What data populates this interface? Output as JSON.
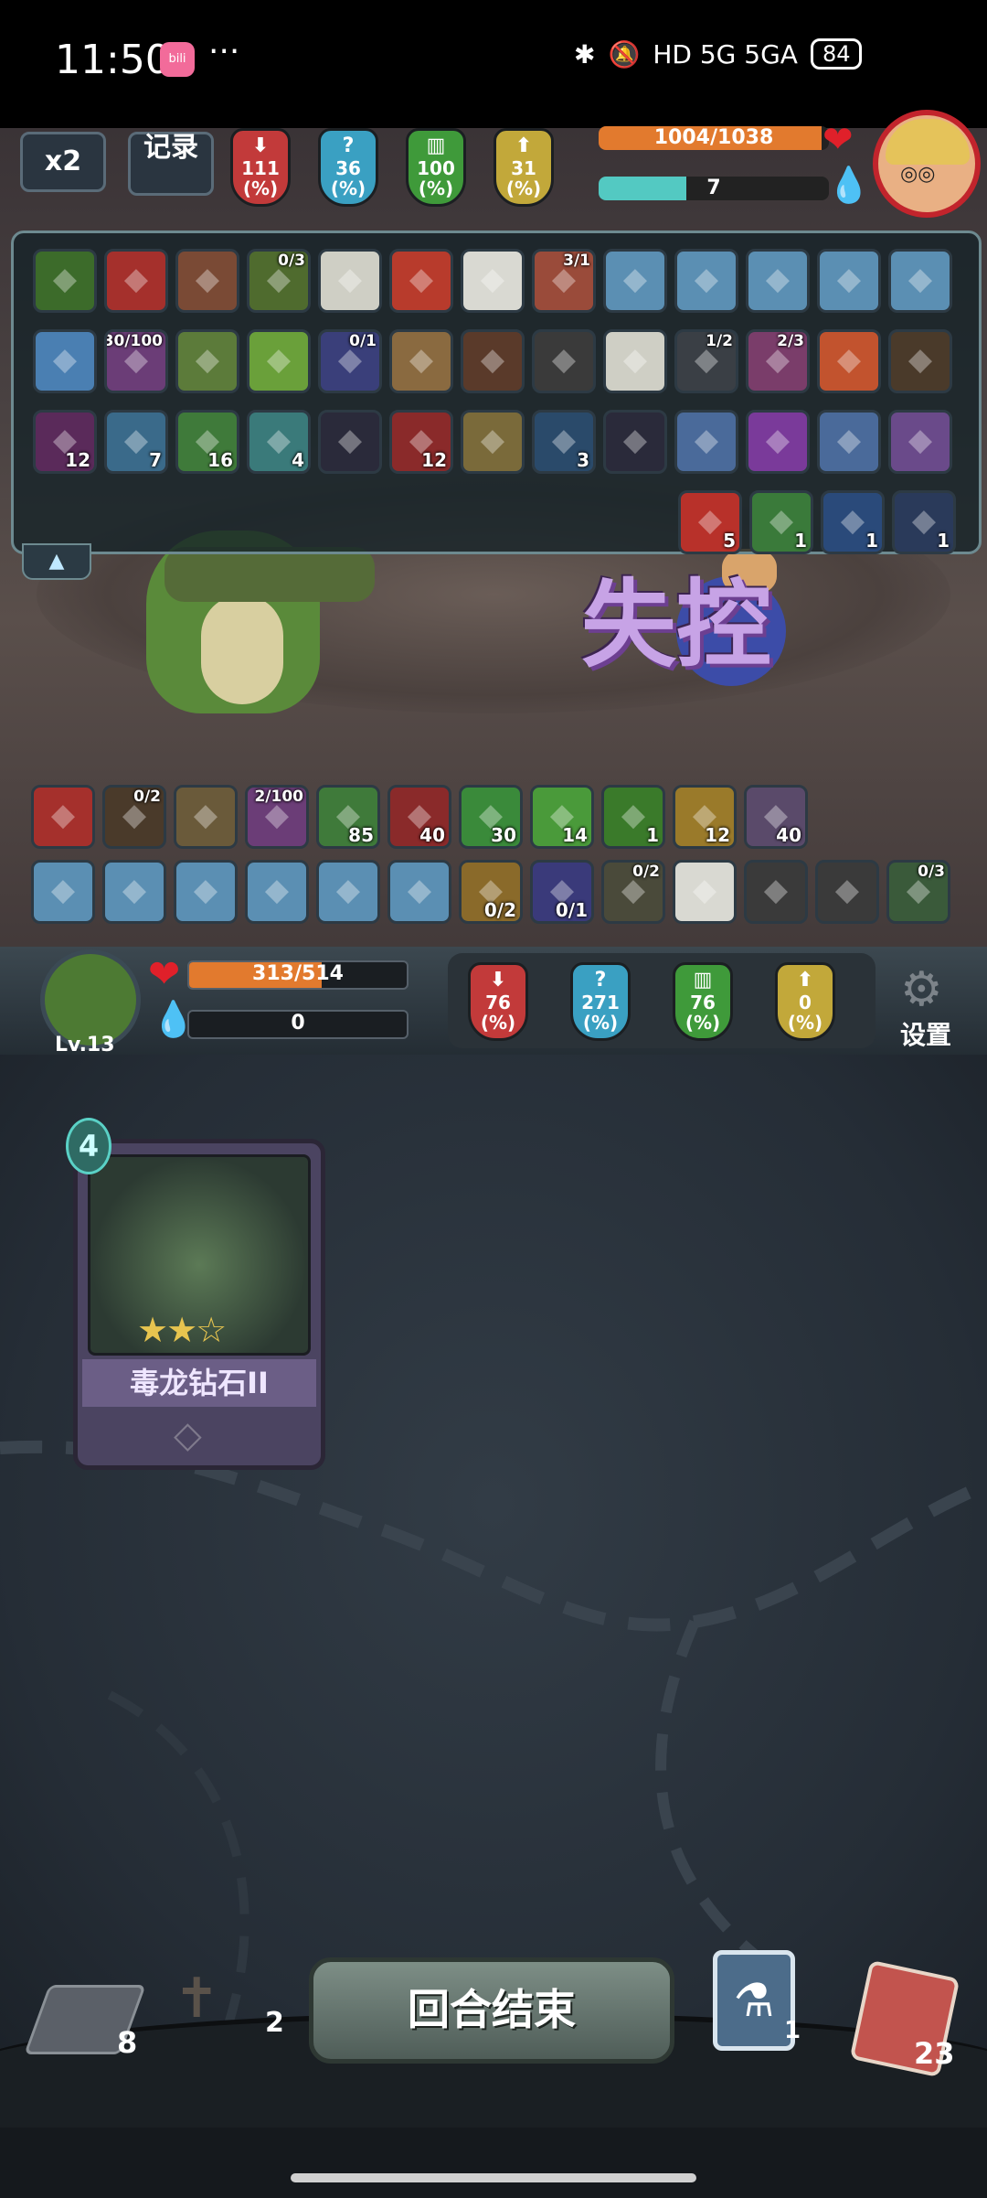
{
  "status_bar": {
    "time": "11:50",
    "app_icon": "bilibili",
    "more": "···",
    "network": "HD 5G 5GA",
    "battery": "84"
  },
  "controls": {
    "speed": "x2",
    "record": "记录"
  },
  "enemy": {
    "hp_text": "1004/1038",
    "hp": 1004,
    "hp_max": 1038,
    "energy": "7",
    "energy_fraction": 0.38,
    "stats": [
      {
        "value": "111",
        "unit": "(%)",
        "icon": "attack-down-icon",
        "color": "#c23a3a"
      },
      {
        "value": "36",
        "unit": "(%)",
        "icon": "unknown-icon",
        "color": "#3aa0c2"
      },
      {
        "value": "100",
        "unit": "(%)",
        "icon": "defense-icon",
        "color": "#3f9a3a"
      },
      {
        "value": "31",
        "unit": "(%)",
        "icon": "crit-icon",
        "color": "#c2a83a"
      }
    ]
  },
  "buff_rows": [
    [
      {
        "icon": "slime-icon",
        "color": "#3c6b2a",
        "tl": "",
        "br": ""
      },
      {
        "icon": "red-demon-icon",
        "color": "#a5302c",
        "tl": "",
        "br": ""
      },
      {
        "icon": "meat-icon",
        "color": "#7a4a35",
        "tl": "",
        "br": ""
      },
      {
        "icon": "zombie-icon",
        "color": "#4f6b2e",
        "tl": "0/3",
        "br": ""
      },
      {
        "icon": "riceball-icon",
        "color": "#cfcfc5",
        "tl": "",
        "br": ""
      },
      {
        "icon": "flask-icon",
        "color": "#b83b2c",
        "tl": "",
        "br": ""
      },
      {
        "icon": "ghost-icon",
        "color": "#d9d9d2",
        "tl": "",
        "br": ""
      },
      {
        "icon": "brute-icon",
        "color": "#9a4b3a",
        "tl": "3/1",
        "br": ""
      },
      {
        "icon": "pumpkin-icon",
        "color": "#5b8fb3",
        "tl": "",
        "br": ""
      },
      {
        "icon": "eye-icon",
        "color": "#5b8fb3",
        "tl": "",
        "br": ""
      },
      {
        "icon": "tentacle-icon",
        "color": "#5b8fb3",
        "tl": "",
        "br": ""
      },
      {
        "icon": "fist-icon",
        "color": "#5b8fb3",
        "tl": "",
        "br": ""
      },
      {
        "icon": "vortex-icon",
        "color": "#5b8fb3",
        "tl": "",
        "br": ""
      }
    ],
    [
      {
        "icon": "swirl-icon",
        "color": "#4a7fb2",
        "tl": "",
        "br": ""
      },
      {
        "icon": "purple-ogre-icon",
        "color": "#6b3d77",
        "tl": "30/100",
        "br": ""
      },
      {
        "icon": "dagger-icon",
        "color": "#5c7b3a",
        "tl": "",
        "br": ""
      },
      {
        "icon": "cup-icon",
        "color": "#6aa03a",
        "tl": "",
        "br": ""
      },
      {
        "icon": "galaxy-icon",
        "color": "#3a3f7a",
        "tl": "0/1",
        "br": ""
      },
      {
        "icon": "hat-icon",
        "color": "#8a6a40",
        "tl": "",
        "br": ""
      },
      {
        "icon": "glove-icon",
        "color": "#5a3a2a",
        "tl": "",
        "br": ""
      },
      {
        "icon": "trap-icon",
        "color": "#3a3a3a",
        "tl": "",
        "br": ""
      },
      {
        "icon": "boot-icon",
        "color": "#cfcfc5",
        "tl": "",
        "br": ""
      },
      {
        "icon": "binocular-icon",
        "color": "#3a3f45",
        "tl": "1/2",
        "br": ""
      },
      {
        "icon": "worm-icon",
        "color": "#7a3d6a",
        "tl": "2/3",
        "br": ""
      },
      {
        "icon": "book-icon",
        "color": "#c2532e",
        "tl": "",
        "br": ""
      },
      {
        "icon": "wood-icon",
        "color": "#4a3a2a",
        "tl": "",
        "br": ""
      }
    ],
    [
      {
        "icon": "silhouette-down-icon",
        "color": "#5a2a5a",
        "tl": "",
        "br": "12"
      },
      {
        "icon": "muscle-icon",
        "color": "#3a6a8a",
        "tl": "",
        "br": "7"
      },
      {
        "icon": "poison-skull-icon",
        "color": "#3f7a3a",
        "tl": "",
        "br": "16"
      },
      {
        "icon": "target-icon",
        "color": "#3a7a7a",
        "tl": "",
        "br": "4"
      },
      {
        "icon": "shadow-icon",
        "color": "#2a2a3a",
        "tl": "",
        "br": ""
      },
      {
        "icon": "slash-icon",
        "color": "#8a2a2a",
        "tl": "",
        "br": "12"
      },
      {
        "icon": "sun-icon",
        "color": "#7a6a3a",
        "tl": "",
        "br": ""
      },
      {
        "icon": "lightning-icon",
        "color": "#2a4a6a",
        "tl": "",
        "br": "3"
      },
      {
        "icon": "shadow-icon",
        "color": "#2a2a3a",
        "tl": "",
        "br": ""
      },
      {
        "icon": "crystal-icon",
        "color": "#4a6a9a",
        "tl": "",
        "br": ""
      },
      {
        "icon": "crystal-icon",
        "color": "#7a3a9a",
        "tl": "",
        "br": ""
      },
      {
        "icon": "crystal-icon",
        "color": "#4a6a9a",
        "tl": "",
        "br": ""
      },
      {
        "icon": "crystal-icon",
        "color": "#6a4a8a",
        "tl": "",
        "br": ""
      }
    ],
    [
      {
        "icon": "red-figure-icon",
        "color": "#b8312a",
        "tl": "",
        "br": "5"
      },
      {
        "icon": "wing-icon",
        "color": "#3a7a3a",
        "tl": "",
        "br": "1"
      },
      {
        "icon": "shield-icon",
        "color": "#2a4a7a",
        "tl": "",
        "br": "1"
      },
      {
        "icon": "spark-icon",
        "color": "#2a3a5a",
        "tl": "",
        "br": "1"
      }
    ]
  ],
  "status_effect": "失控",
  "player_buff_rows": [
    [
      {
        "icon": "steak-icon",
        "color": "#a5302c",
        "tl": "",
        "br": ""
      },
      {
        "icon": "boots-icon",
        "color": "#4a3a2a",
        "tl": "0/2",
        "br": ""
      },
      {
        "icon": "helmet-icon",
        "color": "#6a5a3a",
        "tl": "",
        "br": ""
      },
      {
        "icon": "purple-ogre-icon",
        "color": "#6b3d77",
        "tl": "2/100",
        "br": ""
      },
      {
        "icon": "poison-skull-icon",
        "color": "#3f7a3a",
        "tl": "",
        "br": "85"
      },
      {
        "icon": "slash-icon",
        "color": "#8a2a2a",
        "tl": "",
        "br": "40"
      },
      {
        "icon": "venom-icon",
        "color": "#3a8a3a",
        "tl": "",
        "br": "30"
      },
      {
        "icon": "blade-icon",
        "color": "#4a9a3a",
        "tl": "",
        "br": "14"
      },
      {
        "icon": "slime-blob-icon",
        "color": "#3a7a2a",
        "tl": "",
        "br": "1"
      },
      {
        "icon": "thunder-icon",
        "color": "#9a7a2a",
        "tl": "",
        "br": "12"
      },
      {
        "icon": "spiral-icon",
        "color": "#5a4a6a",
        "tl": "",
        "br": "40"
      }
    ],
    [
      {
        "icon": "axes-icon",
        "color": "#5b8fb3",
        "tl": "",
        "br": ""
      },
      {
        "icon": "bow-icon",
        "color": "#5b8fb3",
        "tl": "",
        "br": ""
      },
      {
        "icon": "flame-icon",
        "color": "#5b8fb3",
        "tl": "",
        "br": ""
      },
      {
        "icon": "skull-icon",
        "color": "#5b8fb3",
        "tl": "",
        "br": ""
      },
      {
        "icon": "fist-icon",
        "color": "#5b8fb3",
        "tl": "",
        "br": ""
      },
      {
        "icon": "runner-icon",
        "color": "#5b8fb3",
        "tl": "",
        "br": ""
      },
      {
        "icon": "scroll-icon",
        "color": "#8a6a2a",
        "tl": "",
        "br": "0/2"
      },
      {
        "icon": "telescope-icon",
        "color": "#3a3a7a",
        "tl": "",
        "br": "0/1"
      },
      {
        "icon": "soldier-icon",
        "color": "#4a4a3a",
        "tl": "0/2",
        "br": ""
      },
      {
        "icon": "ghost-icon",
        "color": "#d9d9d2",
        "tl": "",
        "br": ""
      },
      {
        "icon": "staff-icon",
        "color": "#3a3a3a",
        "tl": "",
        "br": ""
      },
      {
        "icon": "trap-icon",
        "color": "#3a3a3a",
        "tl": "",
        "br": ""
      },
      {
        "icon": "plant-icon",
        "color": "#3a5a3a",
        "tl": "0/3",
        "br": ""
      }
    ]
  ],
  "player": {
    "level": "Lv.13",
    "hp_text": "313/514",
    "hp": 313,
    "hp_max": 514,
    "energy": "0",
    "stats": [
      {
        "value": "76",
        "unit": "(%)",
        "icon": "attack-down-icon",
        "color": "#c23a3a"
      },
      {
        "value": "271",
        "unit": "(%)",
        "icon": "unknown-icon",
        "color": "#3aa0c2"
      },
      {
        "value": "76",
        "unit": "(%)",
        "icon": "defense-icon",
        "color": "#3f9a3a"
      },
      {
        "value": "0",
        "unit": "(%)",
        "icon": "crit-icon",
        "color": "#c2a83a"
      }
    ],
    "settings": "设置"
  },
  "card": {
    "cost": "4",
    "name": "毒龙钻石II",
    "stars_filled": 2,
    "stars_total": 3
  },
  "bottom": {
    "draw_count": "8",
    "grave_count": "2",
    "end_turn": "回合结束",
    "potion_count": "1",
    "discard_count": "23"
  }
}
